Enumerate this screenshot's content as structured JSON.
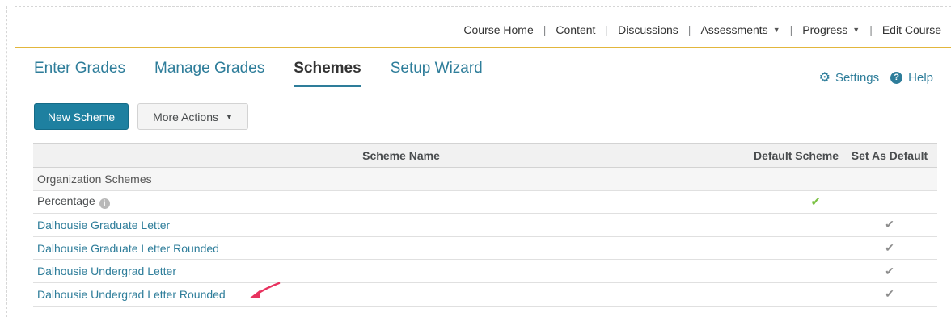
{
  "course_nav": {
    "items": [
      {
        "label": "Course Home",
        "caret": false
      },
      {
        "label": "Content",
        "caret": false
      },
      {
        "label": "Discussions",
        "caret": false
      },
      {
        "label": "Assessments",
        "caret": true
      },
      {
        "label": "Progress",
        "caret": true
      },
      {
        "label": "Edit Course",
        "caret": false
      }
    ],
    "accent_color": "#e2b63c"
  },
  "tabs": [
    {
      "label": "Enter Grades",
      "active": false
    },
    {
      "label": "Manage Grades",
      "active": false
    },
    {
      "label": "Schemes",
      "active": true
    },
    {
      "label": "Setup Wizard",
      "active": false
    }
  ],
  "header_links": {
    "settings": "Settings",
    "help": "Help"
  },
  "toolbar": {
    "new_scheme": "New Scheme",
    "more_actions": "More Actions"
  },
  "table": {
    "columns": {
      "name": "Scheme Name",
      "default": "Default Scheme",
      "set_default": "Set As Default"
    },
    "group_label": "Organization Schemes",
    "rows": [
      {
        "name": "Percentage",
        "info": true,
        "link": false,
        "is_default": true,
        "can_set_default": false
      },
      {
        "name": "Dalhousie Graduate Letter",
        "info": false,
        "link": true,
        "is_default": false,
        "can_set_default": true
      },
      {
        "name": "Dalhousie Graduate Letter Rounded",
        "info": false,
        "link": true,
        "is_default": false,
        "can_set_default": true
      },
      {
        "name": "Dalhousie Undergrad Letter",
        "info": false,
        "link": true,
        "is_default": false,
        "can_set_default": true
      },
      {
        "name": "Dalhousie Undergrad Letter Rounded",
        "info": false,
        "link": true,
        "is_default": false,
        "can_set_default": true
      }
    ]
  },
  "colors": {
    "link": "#2e7d9a",
    "primary_button": "#1e80a0",
    "default_check": "#7ac142",
    "annotation_arrow": "#e8325f"
  }
}
